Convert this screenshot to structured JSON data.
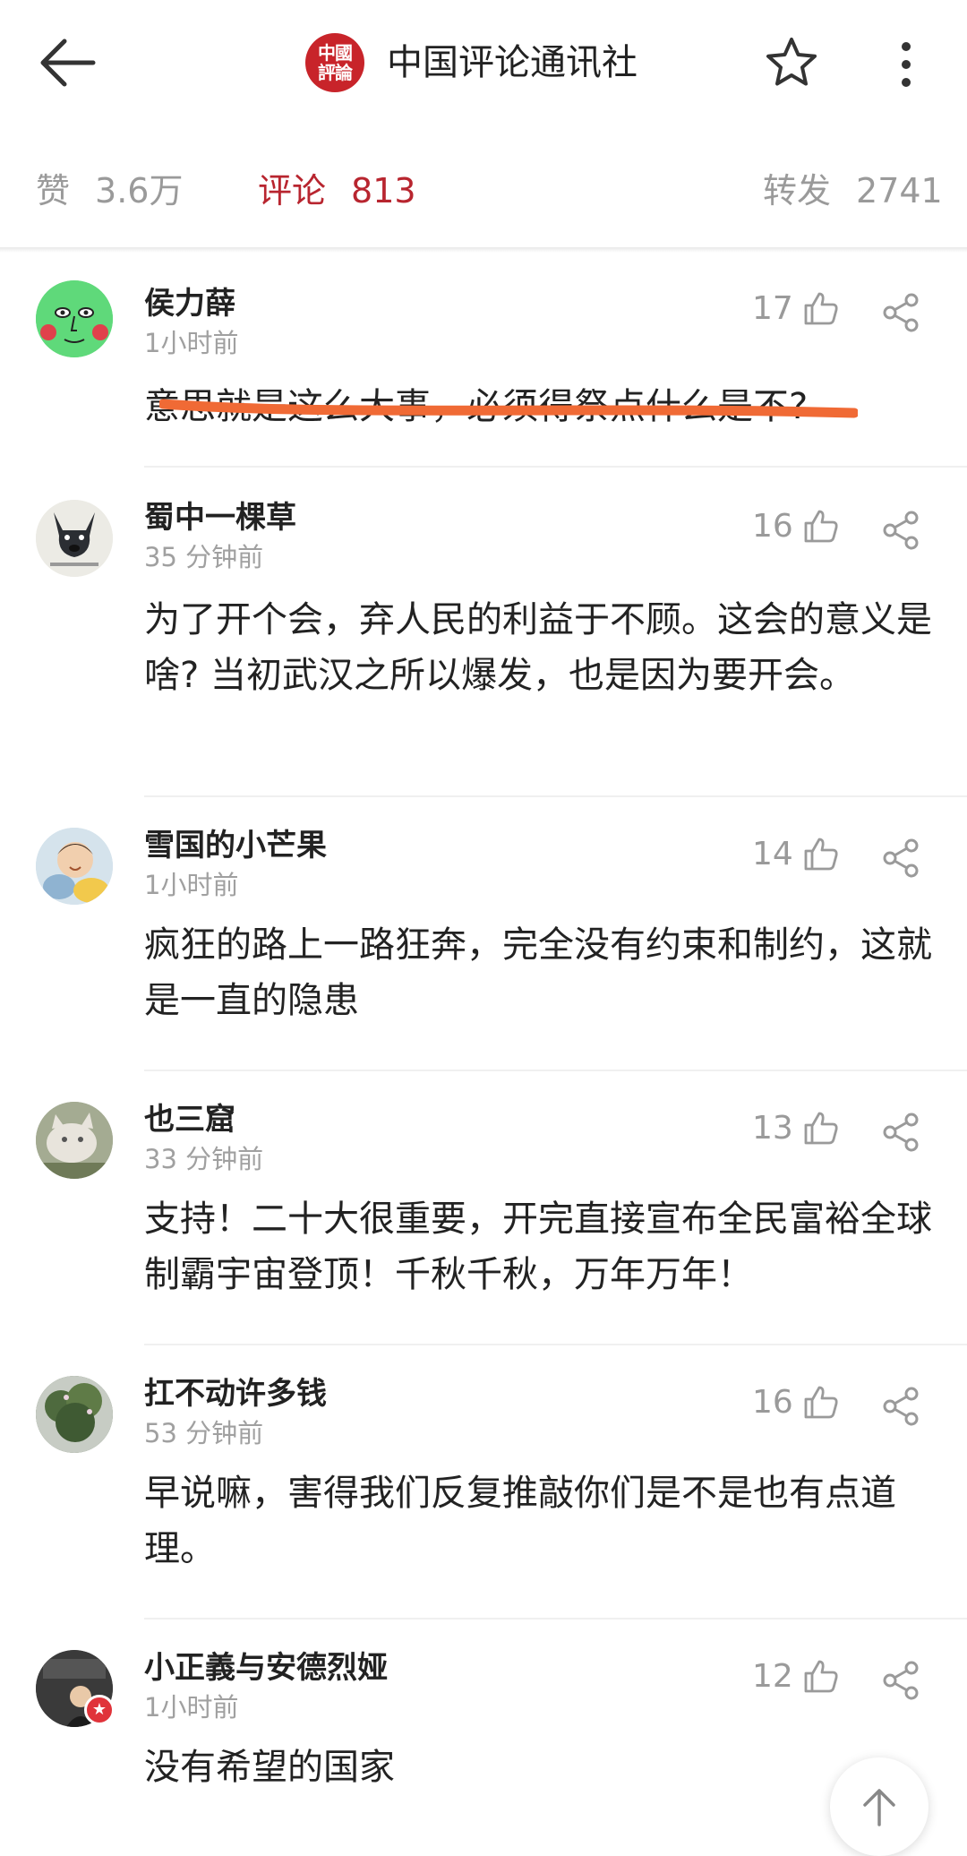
{
  "header": {
    "title": "中国评论通讯社",
    "logo_text": "中國評論"
  },
  "stats": {
    "likes_label": "赞",
    "likes_value": "3.6万",
    "comments_label": "评论",
    "comments_value": "813",
    "reposts_label": "转发",
    "reposts_value": "2741"
  },
  "comments": [
    {
      "user": "侯力薛",
      "time": "1小时前",
      "likes": "17",
      "text": "意思就是这么大事，必须得祭点什么是不?"
    },
    {
      "user": "蜀中一棵草",
      "time": "35 分钟前",
      "likes": "16",
      "text": "为了开个会，弃人民的利益于不顾。这会的意义是啥? 当初武汉之所以爆发，也是因为要开会。"
    },
    {
      "user": "雪国的小芒果",
      "time": "1小时前",
      "likes": "14",
      "text": "疯狂的路上一路狂奔，完全没有约束和制约，这就是一直的隐患"
    },
    {
      "user": "也三窟",
      "time": "33 分钟前",
      "likes": "13",
      "text": "支持！二十大很重要，开完直接宣布全民富裕全球制霸宇宙登顶！千秋千秋，万年万年！"
    },
    {
      "user": "扛不动许多钱",
      "time": "53 分钟前",
      "likes": "16",
      "text": "早说嘛，害得我们反复推敲你们是不是也有点道理。"
    },
    {
      "user": "小正義与安德烈娅",
      "time": "1小时前",
      "likes": "12",
      "text": "没有希望的国家"
    }
  ],
  "colors": {
    "accent": "#b8252f",
    "underline": "#f06a35",
    "muted": "#9a9a9a"
  }
}
